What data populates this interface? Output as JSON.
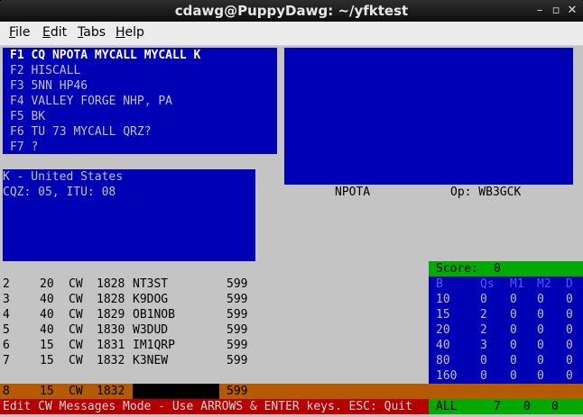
{
  "window": {
    "title": "cdawg@PuppyDawg: ~/yfktest"
  },
  "menu": [
    {
      "label": "File",
      "accel": "F"
    },
    {
      "label": "Edit",
      "accel": "E"
    },
    {
      "label": "Tabs",
      "accel": "T"
    },
    {
      "label": "Help",
      "accel": "H"
    }
  ],
  "messages": [
    "F1 CQ NPOTA MYCALL MYCALL K",
    "F2 HISCALL",
    "F3 5NN HP46",
    "F4 VALLEY FORGE NHP, PA",
    "F5 BK",
    "F6 TU 73 MYCALL QRZ?",
    "F7 ?"
  ],
  "country": {
    "line1": "K - United States",
    "line2": "CQZ: 05, ITU: 08"
  },
  "contest_name": "NPOTA",
  "operator": "Op: WB3GCK",
  "log_rows": [
    {
      "nr": "2",
      "band": "20",
      "mode": "CW",
      "time": "1828",
      "call": "NT3ST",
      "rst": "599"
    },
    {
      "nr": "3",
      "band": "40",
      "mode": "CW",
      "time": "1828",
      "call": "K9DOG",
      "rst": "599"
    },
    {
      "nr": "4",
      "band": "40",
      "mode": "CW",
      "time": "1829",
      "call": "OB1NOB",
      "rst": "599"
    },
    {
      "nr": "5",
      "band": "40",
      "mode": "CW",
      "time": "1830",
      "call": "W3DUD",
      "rst": "599"
    },
    {
      "nr": "6",
      "band": "15",
      "mode": "CW",
      "time": "1831",
      "call": "IM1QRP",
      "rst": "599"
    },
    {
      "nr": "7",
      "band": "15",
      "mode": "CW",
      "time": "1832",
      "call": "K3NEW",
      "rst": "599"
    }
  ],
  "entry_row": {
    "nr": "8",
    "band": "15",
    "mode": "CW",
    "time": "1832",
    "call": "",
    "rst": "599"
  },
  "score": {
    "label": "Score:",
    "value": "0",
    "headers": [
      "B",
      "Qs",
      "M1",
      "M2",
      "D"
    ],
    "rows": [
      [
        "10",
        "0",
        "0",
        "0",
        "0"
      ],
      [
        "15",
        "2",
        "0",
        "0",
        "0"
      ],
      [
        "20",
        "2",
        "0",
        "0",
        "0"
      ],
      [
        "40",
        "3",
        "0",
        "0",
        "0"
      ],
      [
        "80",
        "0",
        "0",
        "0",
        "0"
      ],
      [
        "160",
        "0",
        "0",
        "0",
        "0"
      ]
    ],
    "total": [
      "ALL",
      "7",
      "0",
      "0"
    ]
  },
  "status": "Edit CW Messages Mode - Use ARROWS & ENTER keys. ESC: Quit",
  "colors": {
    "panel_blue": "#0000b4",
    "score_green": "#00aa00",
    "entry_orange": "#b45a00",
    "status_red": "#b40000",
    "terminal_gray": "#c4c4c4"
  }
}
